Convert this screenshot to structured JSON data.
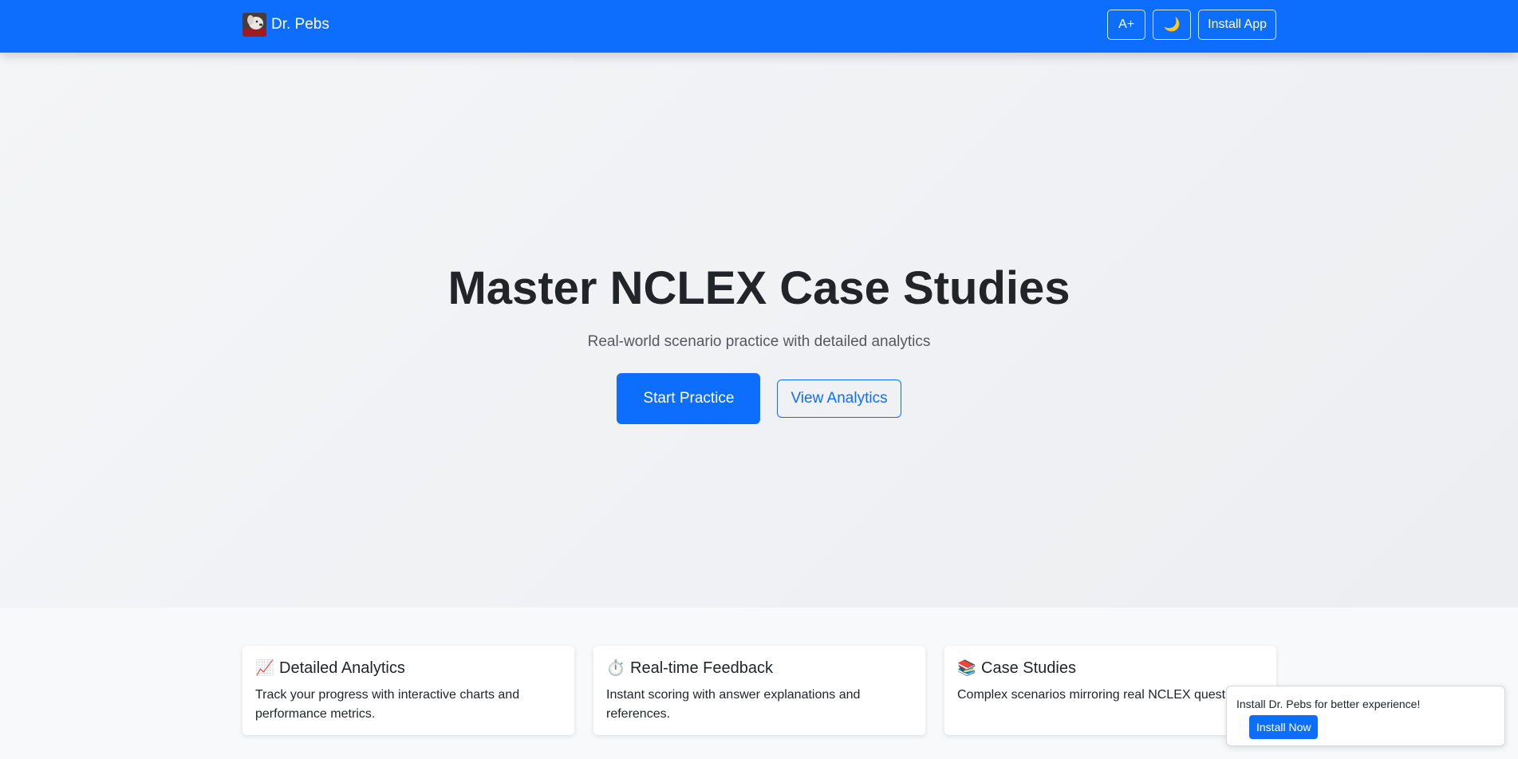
{
  "app": {
    "brand_name": "Dr. Pebs",
    "logo_icon": "dog-avatar-icon"
  },
  "navbar": {
    "font_size_label": "A+",
    "dark_mode_icon": "🌙",
    "install_label": "Install App"
  },
  "hero": {
    "title": "Master NCLEX Case Studies",
    "subtitle": "Real-world scenario practice with detailed analytics",
    "primary_button": "Start Practice",
    "secondary_button": "View Analytics"
  },
  "features": [
    {
      "icon": "📈",
      "icon_name": "chart-icon",
      "title": "Detailed Analytics",
      "text": "Track your progress with interactive charts and performance metrics."
    },
    {
      "icon": "⏱️",
      "icon_name": "stopwatch-icon",
      "title": "Real-time Feedback",
      "text": "Instant scoring with answer explanations and references."
    },
    {
      "icon": "📚",
      "icon_name": "books-icon",
      "title": "Case Studies",
      "text": "Complex scenarios mirroring real NCLEX questions."
    }
  ],
  "install_prompt": {
    "message": "Install Dr. Pebs for better experience!",
    "button": "Install Now"
  },
  "colors": {
    "primary": "#0d6efd",
    "heading": "#212529"
  }
}
